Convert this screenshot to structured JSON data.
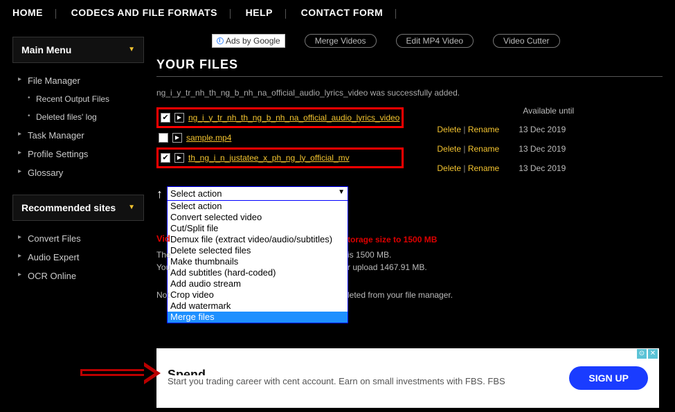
{
  "nav": {
    "items": [
      "HOME",
      "CODECS AND FILE FORMATS",
      "HELP",
      "CONTACT FORM"
    ]
  },
  "sidebar": {
    "main_menu": {
      "title": "Main Menu",
      "items": [
        {
          "label": "File Manager",
          "sub": [
            "Recent Output Files",
            "Deleted files' log"
          ]
        },
        {
          "label": "Task Manager"
        },
        {
          "label": "Profile Settings"
        },
        {
          "label": "Glossary"
        }
      ]
    },
    "recommended": {
      "title": "Recommended sites",
      "items": [
        "Convert Files",
        "Audio Expert",
        "OCR Online"
      ]
    }
  },
  "ads_row": {
    "badge": "Ads by Google",
    "links": [
      "Merge Videos",
      "Edit MP4 Video",
      "Video Cutter"
    ]
  },
  "heading": "YOUR FILES",
  "status": "ng_i_y_tr_nh_th_ng_b_nh_na_official_audio_lyrics_video was successfully added.",
  "file_table": {
    "available_header": "Available until",
    "rows": [
      {
        "checked": true,
        "highlighted": true,
        "name": "ng_i_y_tr_nh_th_ng_b_nh_na_official_audio_lyrics_video",
        "delete": "Delete",
        "rename": "Rename",
        "date": "13 Dec 2019"
      },
      {
        "checked": false,
        "highlighted": false,
        "name": "sample.mp4",
        "delete": "Delete",
        "rename": "Rename",
        "date": "13 Dec 2019"
      },
      {
        "checked": true,
        "highlighted": true,
        "name": "th_ng_i_n_justatee_x_ph_ng_ly_official_mv",
        "delete": "Delete",
        "rename": "Rename",
        "date": "13 Dec 2019"
      }
    ]
  },
  "select": {
    "placeholder": "Select action",
    "options": [
      "Select action",
      "Convert selected video",
      "Cut/Split file",
      "Demux file (extract video/audio/subtitles)",
      "Delete selected files",
      "Make thumbnails",
      "Add subtitles (hard-coded)",
      "Add audio stream",
      "Crop video",
      "Add watermark",
      "Merge files"
    ],
    "highlighted_index": 10
  },
  "promo": {
    "title_left": "Vid",
    "title_right": "torage size to 1500 MB",
    "line1_left": "The",
    "line1_right": "is 1500 MB.",
    "line2_left": "You",
    "line2_right": "r upload 1467.91 MB.",
    "note_left": "Not",
    "note_right": "leted from your file manager."
  },
  "ad": {
    "headline_cut": "Spend ____. ____ ____",
    "body": "Start you trading career with cent account. Earn on small investments with FBS. FBS",
    "button": "SIGN UP"
  }
}
